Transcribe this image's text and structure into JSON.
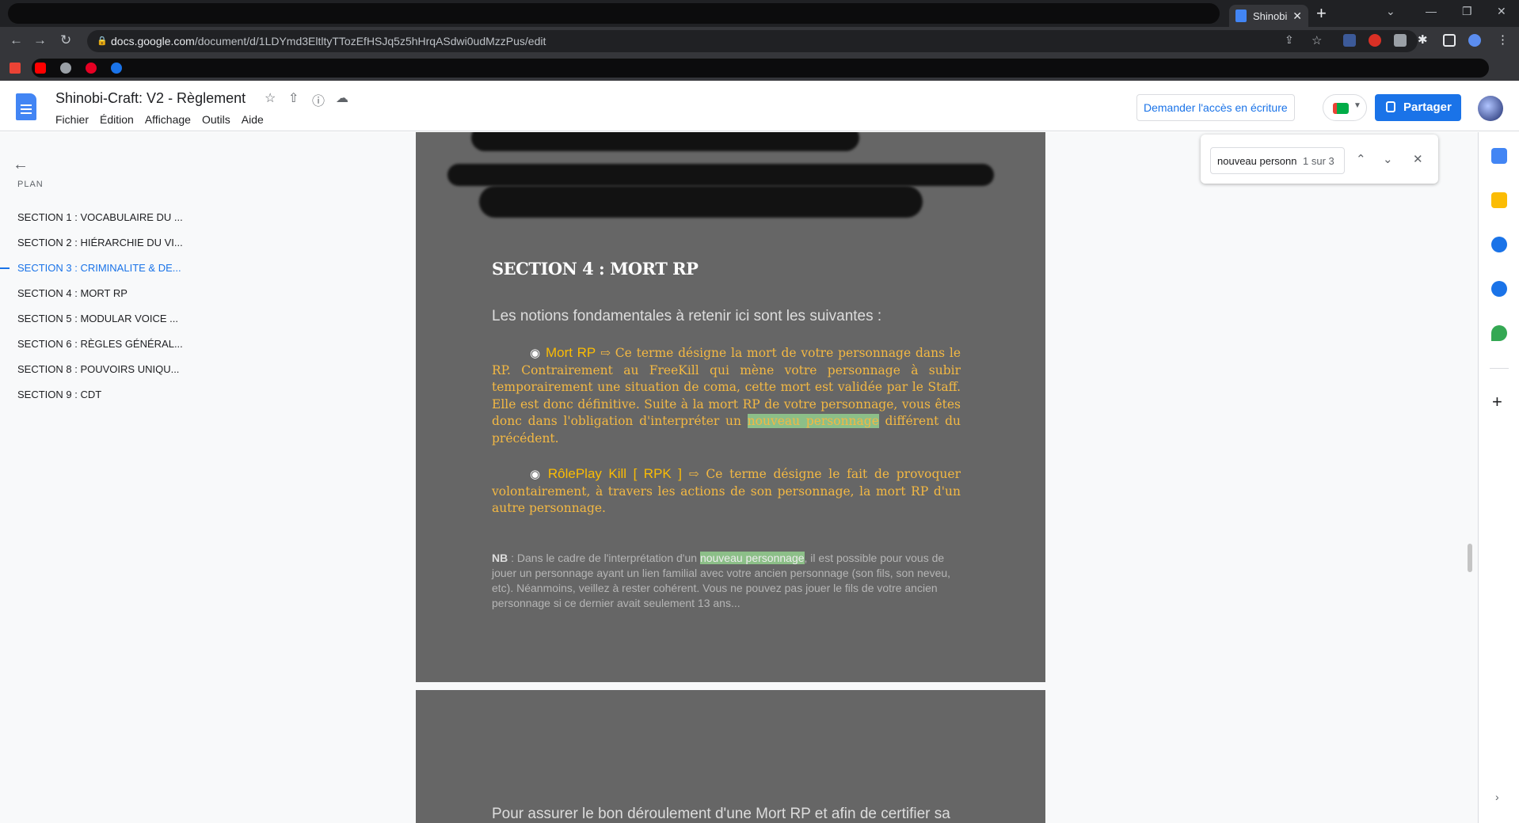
{
  "browser": {
    "active_tab_title": "Shinobi",
    "url_host": "docs.google.com",
    "url_path": "/document/d/1LDYmd3EltltyTTozEfHSJq5z5hHrqASdwi0udMzzPus/edit"
  },
  "docs": {
    "title": "Shinobi-Craft: V2 - Règlement",
    "menu": [
      "Fichier",
      "Édition",
      "Affichage",
      "Outils",
      "Aide"
    ],
    "request_access": "Demander l'accès en écriture",
    "share": "Partager"
  },
  "outline": {
    "label": "PLAN",
    "items": [
      "SECTION 1 : VOCABULAIRE DU ...",
      "SECTION 2 : HIÉRARCHIE DU VI...",
      "SECTION 3 : CRIMINALITE & DE...",
      "SECTION 4 : MORT RP",
      "SECTION 5 : MODULAR VOICE ...",
      "SECTION 6 : RÈGLES GÉNÉRAL...",
      "SECTION 8 : POUVOIRS UNIQU...",
      "SECTION 9 : CDT"
    ],
    "active_index": 2
  },
  "content": {
    "heading": "SECTION 4 : MORT RP",
    "intro": "Les notions fondamentales à retenir ici sont les suivantes :",
    "bullet_symbol": "◉",
    "arrow": "⇨",
    "term1": "Mort RP",
    "def1_a": " Ce terme désigne la mort de votre personnage dans le RP. Contrairement au FreeKill qui mène votre personnage à subir temporairement une situation de coma, cette mort est validée par le Staff. Elle est donc définitive. Suite à la mort RP de votre personnage, vous êtes donc dans l'obligation d'interpréter un ",
    "highlight": "nouveau personnage",
    "def1_b": " différent du précédent.",
    "term2": "RôlePlay Kill  [ RPK ]",
    "def2": " Ce terme désigne le fait de provoquer volontairement, à travers les actions de son personnage, la mort RP d'un autre personnage.",
    "nb_label": "NB",
    "nb_a": " : Dans le cadre de l'interprétation d'un ",
    "nb_b": ", il est possible pour vous de jouer un personnage ayant un lien familial avec votre ancien personnage (son fils, son neveu, etc). Néanmoins, veillez à rester cohérent. Vous ne pouvez pas jouer le fils de votre ancien personnage si ce dernier avait seulement 13 ans...",
    "page2_text": "Pour assurer le bon déroulement d'une Mort RP et afin de certifier sa légitimité, quelques règles sont à respecter :"
  },
  "find": {
    "query": "nouveau personn",
    "count": "1 sur 3"
  },
  "icons": {
    "back": "←",
    "up": "⌃",
    "down": "⌄",
    "close": "✕",
    "plus": "+",
    "chevron": "›"
  },
  "colors": {
    "accent": "#1a73e8",
    "page_bg": "#666666",
    "term_text": "#f3b843",
    "highlight": "#8cbf88"
  }
}
